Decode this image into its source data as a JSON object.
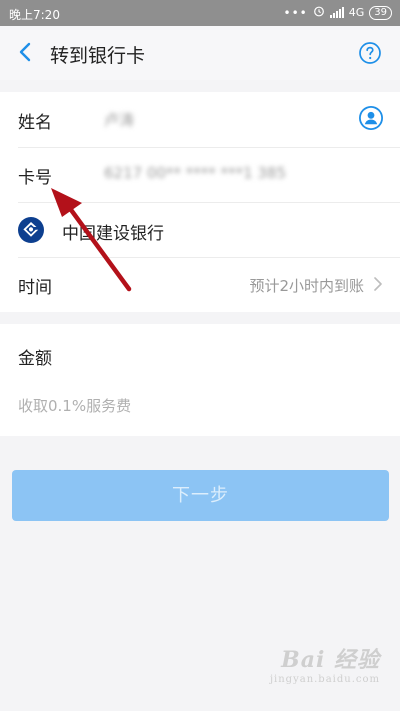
{
  "status_bar": {
    "time": "晚上7:20",
    "dots": "•••",
    "network": "4G",
    "battery": "39"
  },
  "nav": {
    "title": "转到银行卡"
  },
  "form": {
    "name_label": "姓名",
    "name_value": "卢涛",
    "card_label": "卡号",
    "card_value": "6217 00** **** ***1 385",
    "bank_name": "中国建设银行",
    "time_label": "时间",
    "time_value": "预计2小时内到账"
  },
  "amount": {
    "label": "金额",
    "placeholder": "收取0.1%服务费"
  },
  "next_button": {
    "label": "下一步"
  },
  "watermark": {
    "main": "Bai 经验",
    "sub": "jingyan.baidu.com"
  },
  "colors": {
    "accent": "#1e8fe8",
    "button": "#8cc4f4",
    "annotation_arrow": "#b3111a",
    "bank_logo": "#0d3f8f"
  }
}
